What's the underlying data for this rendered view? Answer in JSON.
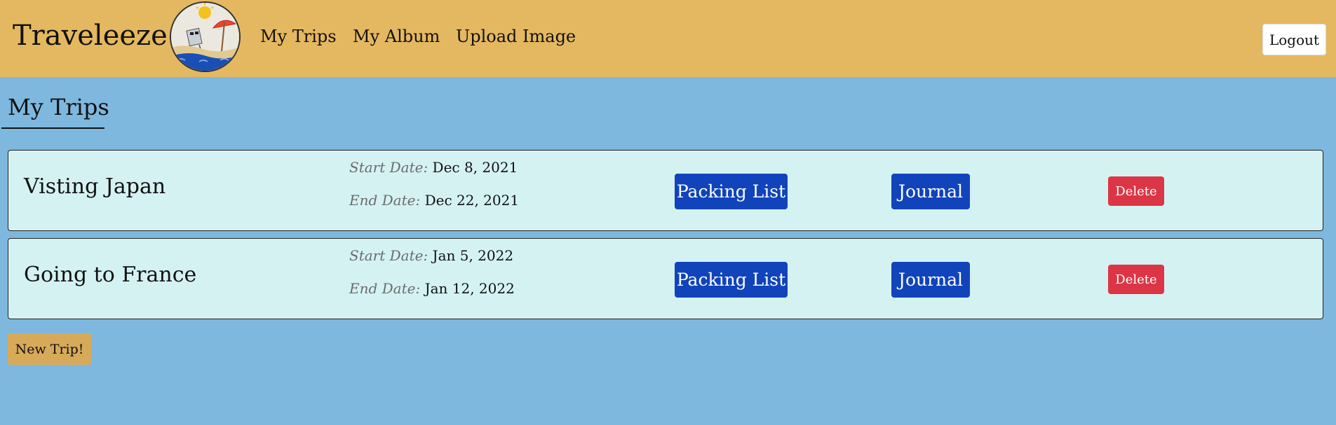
{
  "header": {
    "brand": "Traveleeze",
    "logo_icon": "beach-umbrella-icon",
    "nav": [
      {
        "label": "My Trips"
      },
      {
        "label": "My Album"
      },
      {
        "label": "Upload Image"
      }
    ],
    "logout_label": "Logout"
  },
  "main": {
    "title": "My Trips",
    "trips": [
      {
        "name": "Visting Japan",
        "start_label": "Start Date:",
        "start_date": "Dec 8, 2021",
        "end_label": "End Date:",
        "end_date": "Dec 22, 2021",
        "packing_label": "Packing List",
        "journal_label": "Journal",
        "delete_label": "Delete"
      },
      {
        "name": "Going to France",
        "start_label": "Start Date:",
        "start_date": "Jan 5, 2022",
        "end_label": "End Date:",
        "end_date": "Jan 12, 2022",
        "packing_label": "Packing List",
        "journal_label": "Journal",
        "delete_label": "Delete"
      }
    ],
    "new_trip_label": "New Trip!"
  },
  "colors": {
    "navbar": "#e4b860",
    "background": "#7eb8de",
    "card": "#d5f2f3",
    "primary_button": "#1144bb",
    "danger_button": "#dc3545",
    "new_trip_button": "#d7aa5a"
  }
}
